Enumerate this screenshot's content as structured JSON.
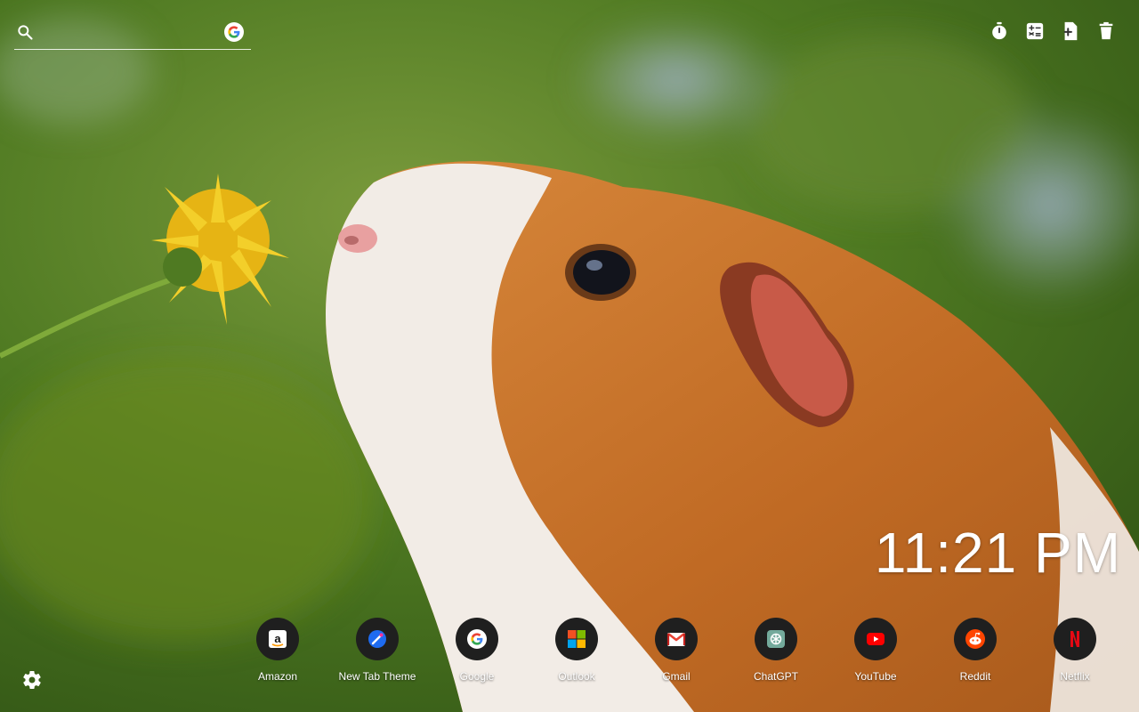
{
  "search": {
    "value": "",
    "placeholder": "",
    "engine_icon": "google-icon"
  },
  "tools": [
    {
      "name": "timer-icon"
    },
    {
      "name": "calculator-icon"
    },
    {
      "name": "add-note-icon"
    },
    {
      "name": "trash-icon"
    }
  ],
  "clock": {
    "time": "11:21 PM"
  },
  "shortcuts": [
    {
      "label": "Amazon",
      "icon": "amazon-icon"
    },
    {
      "label": "New Tab Theme",
      "icon": "new-tab-theme-icon"
    },
    {
      "label": "Google",
      "icon": "google-icon"
    },
    {
      "label": "Outlook",
      "icon": "outlook-icon"
    },
    {
      "label": "Gmail",
      "icon": "gmail-icon"
    },
    {
      "label": "ChatGPT",
      "icon": "chatgpt-icon"
    },
    {
      "label": "YouTube",
      "icon": "youtube-icon"
    },
    {
      "label": "Reddit",
      "icon": "reddit-icon"
    },
    {
      "label": "Netflix",
      "icon": "netflix-icon"
    }
  ],
  "settings": {
    "icon": "gear-icon"
  },
  "colors": {
    "background_green": "#3f6a1a",
    "fur_orange": "#c8762e",
    "dandelion_yellow": "#f0c419",
    "dock_circle": "#1f1f1f"
  }
}
